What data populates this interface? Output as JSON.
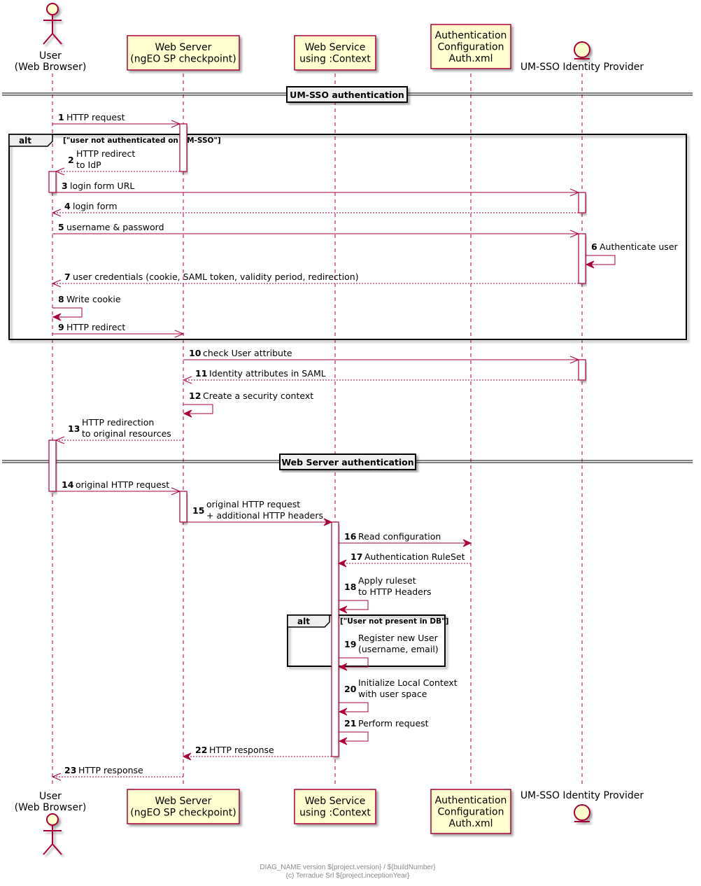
{
  "colors": {
    "line": "#a80036",
    "participant_fill": "#fefece",
    "participant_border": "#a80036",
    "divider_fill": "#eeeeee",
    "frame_border": "#000000",
    "footer_text": "#8a8a8a"
  },
  "participants": [
    {
      "id": "user",
      "kind": "actor",
      "lines": [
        "User",
        "(Web Browser)"
      ],
      "icon": "actor-icon"
    },
    {
      "id": "webserver",
      "kind": "box",
      "lines": [
        "Web Server",
        "(ngEO SP checkpoint)"
      ]
    },
    {
      "id": "webservice",
      "kind": "box",
      "lines": [
        "Web Service",
        "using :Context"
      ]
    },
    {
      "id": "authconf",
      "kind": "box",
      "lines": [
        "Authentication",
        "Configuration",
        "Auth.xml"
      ]
    },
    {
      "id": "idp",
      "kind": "entity",
      "lines": [
        "UM-SSO Identity Provider"
      ],
      "icon": "entity-icon"
    }
  ],
  "dividers": [
    {
      "label": "UM-SSO authentication"
    },
    {
      "label": "Web Server authentication"
    }
  ],
  "alt_frames": [
    {
      "tag": "alt",
      "condition": "[\"user not authenticated on UM-SSO\"]"
    },
    {
      "tag": "alt",
      "condition": "[\"User not present in DB\"]"
    }
  ],
  "messages": [
    {
      "num": "1",
      "from": "user",
      "to": "webserver",
      "lines": [
        "HTTP request"
      ],
      "style": "sync-open"
    },
    {
      "num": "2",
      "from": "webserver",
      "to": "user",
      "lines": [
        "HTTP redirect",
        "to IdP"
      ],
      "style": "return"
    },
    {
      "num": "3",
      "from": "user",
      "to": "idp",
      "lines": [
        "login form URL"
      ],
      "style": "sync-open"
    },
    {
      "num": "4",
      "from": "idp",
      "to": "user",
      "lines": [
        "login form"
      ],
      "style": "return"
    },
    {
      "num": "5",
      "from": "user",
      "to": "idp",
      "lines": [
        "username & password"
      ],
      "style": "sync-open"
    },
    {
      "num": "6",
      "from": "idp",
      "to": "idp",
      "lines": [
        "Authenticate user"
      ],
      "style": "self"
    },
    {
      "num": "7",
      "from": "idp",
      "to": "user",
      "lines": [
        "user credentials (cookie, SAML token, validity period, redirection)"
      ],
      "style": "return"
    },
    {
      "num": "8",
      "from": "user",
      "to": "user",
      "lines": [
        "Write cookie"
      ],
      "style": "self"
    },
    {
      "num": "9",
      "from": "user",
      "to": "webserver",
      "lines": [
        "HTTP redirect"
      ],
      "style": "sync-open"
    },
    {
      "num": "10",
      "from": "webserver",
      "to": "idp",
      "lines": [
        "check User attribute"
      ],
      "style": "sync-open"
    },
    {
      "num": "11",
      "from": "idp",
      "to": "webserver",
      "lines": [
        "Identity attributes in SAML"
      ],
      "style": "return"
    },
    {
      "num": "12",
      "from": "webserver",
      "to": "webserver",
      "lines": [
        "Create a security context"
      ],
      "style": "self"
    },
    {
      "num": "13",
      "from": "webserver",
      "to": "user",
      "lines": [
        "HTTP redirection",
        "to original resources"
      ],
      "style": "return"
    },
    {
      "num": "14",
      "from": "user",
      "to": "webserver",
      "lines": [
        "original HTTP request"
      ],
      "style": "sync-open"
    },
    {
      "num": "15",
      "from": "webserver",
      "to": "webservice",
      "lines": [
        "original HTTP request",
        "+ additional HTTP headers"
      ],
      "style": "sync-filled"
    },
    {
      "num": "16",
      "from": "webservice",
      "to": "authconf",
      "lines": [
        "Read configuration"
      ],
      "style": "sync-filled"
    },
    {
      "num": "17",
      "from": "authconf",
      "to": "webservice",
      "lines": [
        "Authentication RuleSet"
      ],
      "style": "return-filled"
    },
    {
      "num": "18",
      "from": "webservice",
      "to": "webservice",
      "lines": [
        "Apply ruleset",
        "to HTTP Headers"
      ],
      "style": "self"
    },
    {
      "num": "19",
      "from": "webservice",
      "to": "webservice",
      "lines": [
        "Register new User",
        "(username, email)"
      ],
      "style": "self"
    },
    {
      "num": "20",
      "from": "webservice",
      "to": "webservice",
      "lines": [
        "Initialize Local Context",
        "with user space"
      ],
      "style": "self"
    },
    {
      "num": "21",
      "from": "webservice",
      "to": "webservice",
      "lines": [
        "Perform request"
      ],
      "style": "self"
    },
    {
      "num": "22",
      "from": "webservice",
      "to": "webserver",
      "lines": [
        "HTTP response"
      ],
      "style": "return-filled"
    },
    {
      "num": "23",
      "from": "webserver",
      "to": "user",
      "lines": [
        "HTTP response"
      ],
      "style": "return"
    }
  ],
  "footer": {
    "line1": "DIAG_NAME version ${project.version} / ${buildNumber}",
    "line2": "(c) Terradue Srl ${project.inceptionYear}"
  }
}
